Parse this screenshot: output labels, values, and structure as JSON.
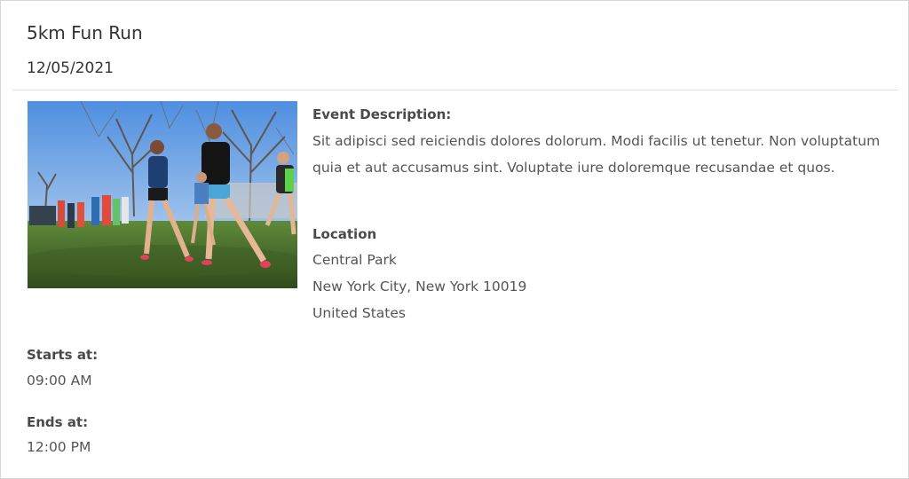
{
  "event": {
    "title": "5km Fun Run",
    "date": "12/05/2021",
    "image_icon": "runners-photo"
  },
  "description": {
    "label": "Event Description:",
    "text": "Sit adipisci sed reiciendis dolores dolorum. Modi facilis ut tenetur. Non voluptatum quia et aut accusamus sint. Voluptate iure doloremque recusandae et quos."
  },
  "location": {
    "label": "Location",
    "venue": "Central Park",
    "city_line": "New York City, New York 10019",
    "country": "United States"
  },
  "schedule": {
    "starts_label": "Starts at:",
    "starts_value": "09:00 AM",
    "ends_label": "Ends at:",
    "ends_value": "12:00 PM"
  },
  "colors": {
    "border": "#d6d6d6",
    "text": "#555555",
    "heading": "#333333"
  }
}
